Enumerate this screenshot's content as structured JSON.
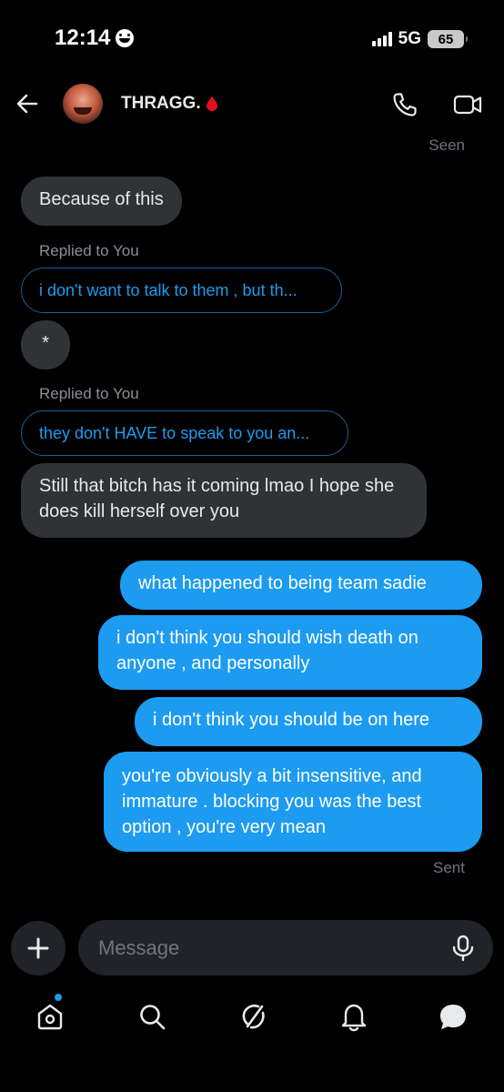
{
  "status_bar": {
    "time": "12:14",
    "network": "5G",
    "battery": "65"
  },
  "header": {
    "contact_name": "THRAGG."
  },
  "conversation": {
    "seen_label": "Seen",
    "sent_label": "Sent",
    "incoming": [
      {
        "text": "Because of this"
      },
      {
        "reply_label": "Replied to You",
        "reply_preview": "i don't want to talk to them , but th...",
        "text": "*"
      },
      {
        "reply_label": "Replied to You",
        "reply_preview": "they don't HAVE to speak to you an...",
        "text": "Still that bitch has it coming lmao I hope she does kill herself over you"
      }
    ],
    "outgoing": [
      {
        "text": "what happened to being team sadie"
      },
      {
        "text": "i don't think you should wish death on anyone , and personally"
      },
      {
        "text": "i don't think you should be on here"
      },
      {
        "text": "you're obviously a bit insensitive, and immature . blocking you was the best option , you're very mean"
      }
    ]
  },
  "composer": {
    "placeholder": "Message",
    "value": ""
  },
  "bottom_nav": {
    "items": [
      "home-icon",
      "search-icon",
      "grok-icon",
      "notifications-icon",
      "messages-icon"
    ]
  },
  "colors": {
    "accent": "#1d9bf0",
    "incoming_bubble": "#2f3336",
    "background": "#000000"
  }
}
